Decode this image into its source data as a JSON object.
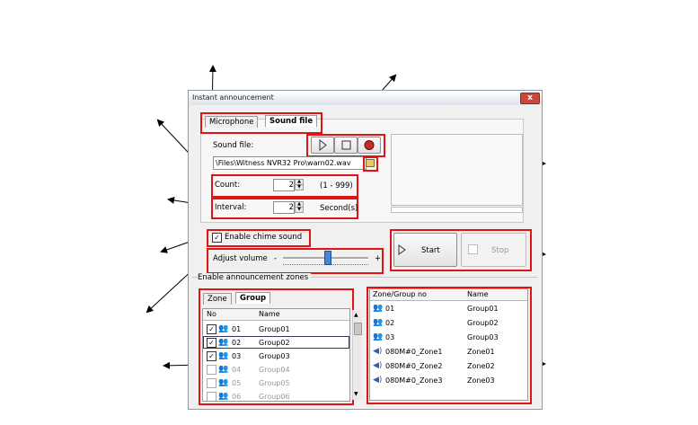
{
  "window": {
    "title": "Instant announcement",
    "close_label": "x"
  },
  "tabs": {
    "microphone": "Microphone",
    "sound_file": "Sound file"
  },
  "sound_file": {
    "label": "Sound file:",
    "path": "\\Files\\Witness NVR32 Pro\\warn02.wav"
  },
  "count": {
    "label": "Count:",
    "value": "2",
    "range": "(1 - 999)"
  },
  "interval": {
    "label": "Interval:",
    "value": "2",
    "unit": "Second(s)"
  },
  "chime": {
    "label": "Enable chime sound",
    "checked": true
  },
  "volume": {
    "label": "Adjust volume",
    "minus": "-",
    "plus": "+",
    "level": 0.52
  },
  "controls": {
    "start": "Start",
    "stop": "Stop"
  },
  "zones_section": {
    "label": "Enable announcement zones",
    "tab_zone": "Zone",
    "tab_group": "Group"
  },
  "left_list": {
    "headers": [
      "No",
      "Name"
    ],
    "rows": [
      {
        "no": "01",
        "name": "Group01",
        "checked": true,
        "enabled": true
      },
      {
        "no": "02",
        "name": "Group02",
        "checked": true,
        "enabled": true
      },
      {
        "no": "03",
        "name": "Group03",
        "checked": true,
        "enabled": true
      },
      {
        "no": "04",
        "name": "Group04",
        "checked": false,
        "enabled": false
      },
      {
        "no": "05",
        "name": "Group05",
        "checked": false,
        "enabled": false
      },
      {
        "no": "06",
        "name": "Group06",
        "checked": false,
        "enabled": false
      }
    ]
  },
  "right_list": {
    "headers": [
      "Zone/Group no",
      "Name"
    ],
    "rows": [
      {
        "no": "01",
        "name": "Group01",
        "icon": "group-icon"
      },
      {
        "no": "02",
        "name": "Group02",
        "icon": "group-icon"
      },
      {
        "no": "03",
        "name": "Group03",
        "icon": "group-icon"
      },
      {
        "no": "080M#0_Zone1",
        "name": "Zone01",
        "icon": "speaker-icon"
      },
      {
        "no": "080M#0_Zone2",
        "name": "Zone02",
        "icon": "speaker-icon"
      },
      {
        "no": "080M#0_Zone3",
        "name": "Zone03",
        "icon": "speaker-icon"
      }
    ]
  },
  "colors": {
    "highlight": "#e01414",
    "window_border": "#8a9ab0"
  }
}
